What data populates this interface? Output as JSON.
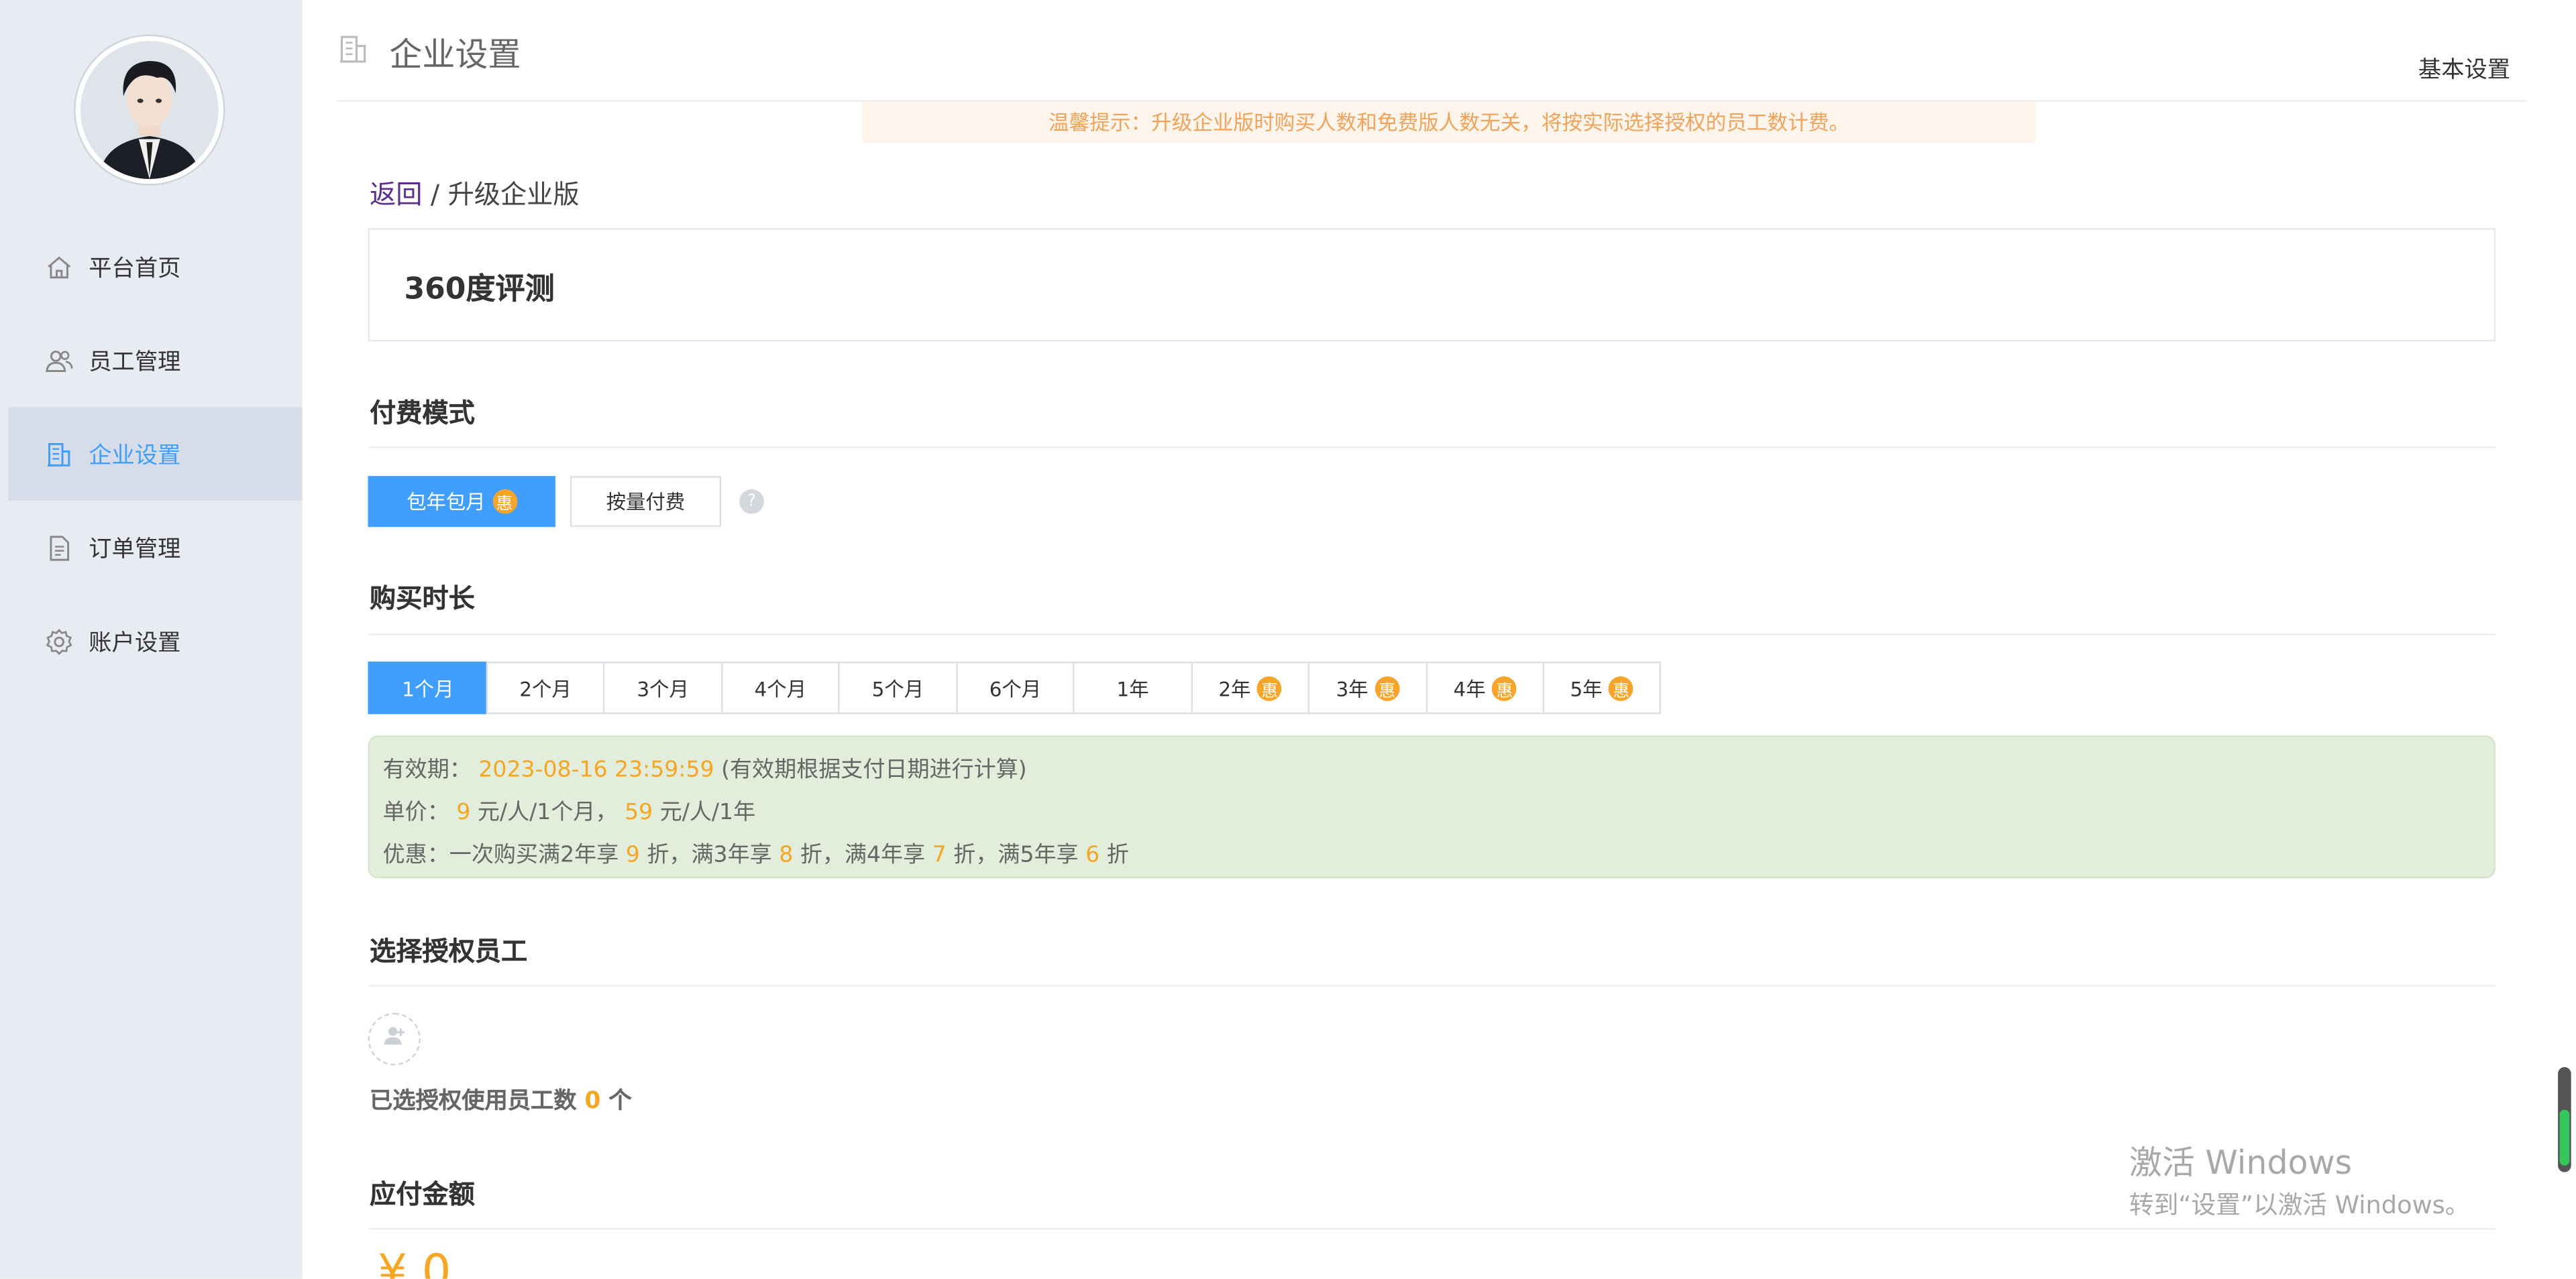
{
  "header": {
    "title": "企业设置",
    "right_link": "基本设置"
  },
  "notice": "温馨提示：升级企业版时购买人数和免费版人数无关，将按实际选择授权的员工数计费。",
  "breadcrumb": {
    "back": "返回",
    "separator": "/",
    "current": "升级企业版"
  },
  "product_name": "360度评测",
  "sidebar": {
    "items": [
      {
        "label": "平台首页",
        "icon": "home-icon",
        "active": false
      },
      {
        "label": "员工管理",
        "icon": "users-icon",
        "active": false
      },
      {
        "label": "企业设置",
        "icon": "building-icon",
        "active": true
      },
      {
        "label": "订单管理",
        "icon": "document-icon",
        "active": false
      },
      {
        "label": "账户设置",
        "icon": "gear-icon",
        "active": false
      }
    ]
  },
  "payment_mode": {
    "title": "付费模式",
    "options": [
      {
        "label": "包年包月",
        "badge": "惠",
        "selected": true
      },
      {
        "label": "按量付费",
        "selected": false
      }
    ],
    "help": "?"
  },
  "duration": {
    "title": "购买时长",
    "options": [
      {
        "label": "1个月",
        "selected": true
      },
      {
        "label": "2个月"
      },
      {
        "label": "3个月"
      },
      {
        "label": "4个月"
      },
      {
        "label": "5个月"
      },
      {
        "label": "6个月"
      },
      {
        "label": "1年"
      },
      {
        "label": "2年",
        "badge": "惠"
      },
      {
        "label": "3年",
        "badge": "惠"
      },
      {
        "label": "4年",
        "badge": "惠"
      },
      {
        "label": "5年",
        "badge": "惠"
      }
    ]
  },
  "info": {
    "validity_label": "有效期：",
    "validity_date": "2023-08-16 23:59:59",
    "validity_note": "(有效期根据支付日期进行计算)",
    "price_label": "单价：",
    "price_month": "9",
    "price_month_unit": "元/人/1个月，",
    "price_year": "59",
    "price_year_unit": "元/人/1年",
    "discount_label": "优惠：一次购买满2年享",
    "d2": "9",
    "d2_text": "折，满3年享",
    "d3": "8",
    "d3_text": "折，满4年享",
    "d4": "7",
    "d4_text": "折，满5年享",
    "d5": "6",
    "d5_text": "折"
  },
  "employees": {
    "title": "选择授权员工",
    "count_label": "已选授权使用员工数",
    "count": "0",
    "count_unit": "个"
  },
  "amount": {
    "title": "应付金额",
    "value": "¥ 0"
  },
  "watermark": {
    "line1": "激活 Windows",
    "line2": "转到“设置”以激活 Windows。"
  },
  "colors": {
    "accent": "#409eff",
    "orange": "#f5a623",
    "sidebar_bg": "#e8ebf1",
    "info_bg": "#e2eedb"
  }
}
